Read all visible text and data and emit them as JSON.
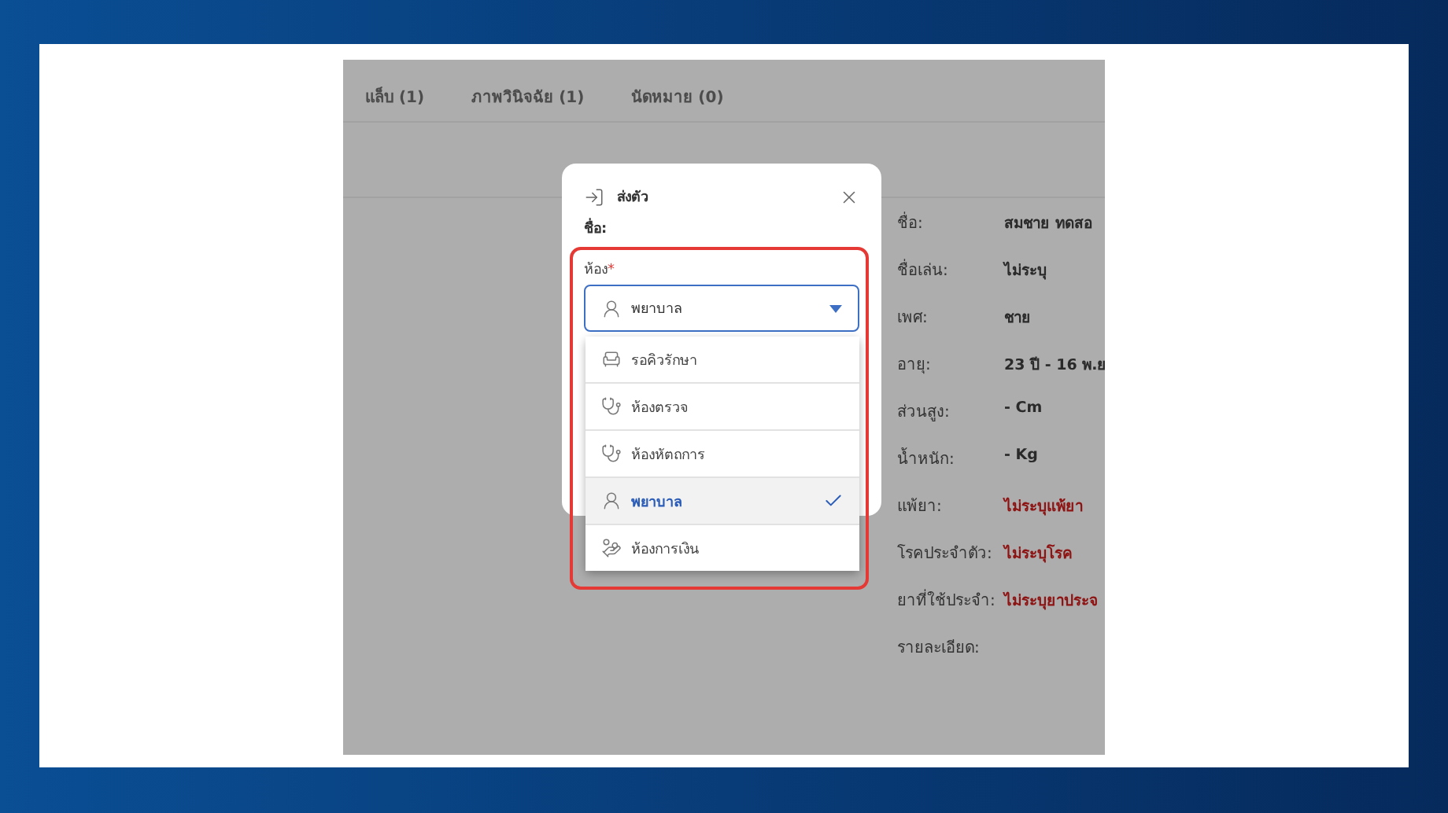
{
  "tabs": [
    {
      "label": "แล็บ (1)"
    },
    {
      "label": "ภาพวินิจฉัย (1)"
    },
    {
      "label": "นัดหมาย (0)"
    }
  ],
  "patient_info": [
    {
      "label": "ชื่อ:",
      "value": "สมชาย ทดสอ",
      "kind": "normal"
    },
    {
      "label": "ชื่อเล่น:",
      "value": "ไม่ระบุ",
      "kind": "normal"
    },
    {
      "label": "เพศ:",
      "value": "ชาย",
      "kind": "normal"
    },
    {
      "label": "อายุ:",
      "value": "23 ปี - 16 พ.ย",
      "kind": "normal"
    },
    {
      "label": "ส่วนสูง:",
      "value": "- Cm",
      "kind": "normal"
    },
    {
      "label": "น้ำหนัก:",
      "value": "- Kg",
      "kind": "normal"
    },
    {
      "label": "แพ้ยา:",
      "value": "ไม่ระบุแพ้ยา",
      "kind": "alert"
    },
    {
      "label": "โรคประจำตัว:",
      "value": "ไม่ระบุโรค",
      "kind": "alert"
    },
    {
      "label": "ยาที่ใช้ประจำ:",
      "value": "ไม่ระบุยาประจ",
      "kind": "alert"
    },
    {
      "label": "รายละเอียด:"
    }
  ],
  "dialog": {
    "title": "ส่งตัว",
    "name_label": "ชื่อ:",
    "room_field": {
      "label": "ห้อง",
      "required_mark": "*",
      "value": "พยาบาล",
      "expanded": true
    },
    "options": [
      {
        "label": "รอคิวรักษา",
        "kind": "waiting",
        "selected": false
      },
      {
        "label": "ห้องตรวจ",
        "kind": "room",
        "selected": false
      },
      {
        "label": "ห้องหัตถการ",
        "kind": "room",
        "selected": false
      },
      {
        "label": "พยาบาล",
        "kind": "nurse",
        "selected": true
      },
      {
        "label": "ห้องการเงิน",
        "kind": "payment",
        "selected": false
      }
    ]
  }
}
